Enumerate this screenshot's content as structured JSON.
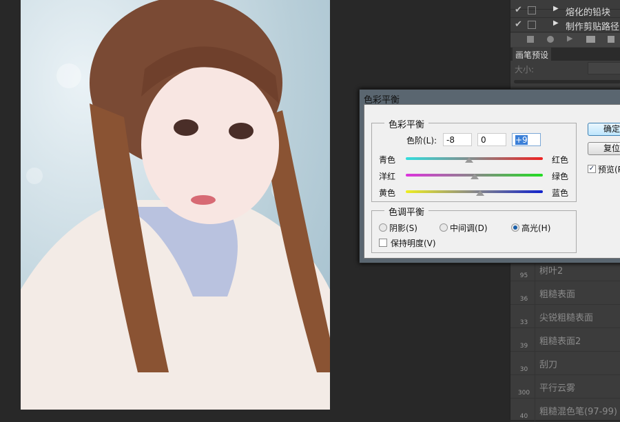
{
  "actions_panel": {
    "rows": [
      {
        "checked": true,
        "label": "熔化的铅块"
      },
      {
        "checked": true,
        "label": "制作剪贴路径"
      }
    ],
    "toolbar_icons": [
      "stop-icon",
      "record-icon",
      "play-icon",
      "folder-icon",
      "new-action-icon"
    ]
  },
  "brush_panel": {
    "tab": "画笔预设",
    "size_label": "大小:",
    "brushes": [
      {
        "size": "95",
        "name": "树叶2"
      },
      {
        "size": "36",
        "name": "粗糙表面"
      },
      {
        "size": "33",
        "name": "尖锐粗糙表面"
      },
      {
        "size": "39",
        "name": "粗糙表面2"
      },
      {
        "size": "30",
        "name": "刮刀"
      },
      {
        "size": "300",
        "name": "平行云雾"
      },
      {
        "size": "40",
        "name": "粗糙混色笔(97-99)"
      }
    ]
  },
  "dialog": {
    "title": "色彩平衡",
    "color_balance": {
      "group": "色彩平衡",
      "levels_label": "色阶(L):",
      "levels": [
        "-8",
        "0",
        "+9"
      ],
      "sliders": [
        {
          "left": "青色",
          "right": "红色",
          "value": -8,
          "from": "#33dddd",
          "to": "#ee2222"
        },
        {
          "left": "洋红",
          "right": "绿色",
          "value": 0,
          "from": "#dd33dd",
          "to": "#22dd22"
        },
        {
          "left": "黄色",
          "right": "蓝色",
          "value": 9,
          "from": "#eeee22",
          "to": "#1122cc"
        }
      ]
    },
    "tone_balance": {
      "group": "色调平衡",
      "options": [
        "阴影(S)",
        "中间调(D)",
        "高光(H)"
      ],
      "selected": 2,
      "preserve_luminosity": "保持明度(V)",
      "preserve_checked": false
    },
    "ok": "确定",
    "reset": "复位",
    "preview": "预览(P)",
    "preview_checked": true
  }
}
